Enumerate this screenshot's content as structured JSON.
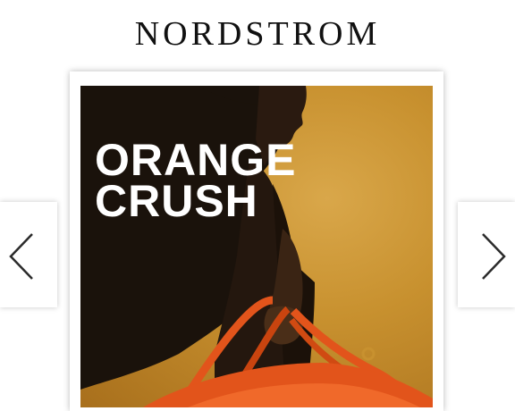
{
  "header": {
    "logo_text": "NORDSTROM"
  },
  "carousel": {
    "slide": {
      "headline_line1": "ORANGE",
      "headline_line2": "CRUSH",
      "image_subject": "model carrying orange leather bag"
    },
    "prev_icon": "chevron-left-icon",
    "next_icon": "chevron-right-icon"
  },
  "colors": {
    "background": "#ffffff",
    "logo": "#111111",
    "hero_gold": "#c8912f",
    "bag_orange": "#e2541b",
    "headline": "#ffffff",
    "chevron": "#2b2b2b"
  }
}
